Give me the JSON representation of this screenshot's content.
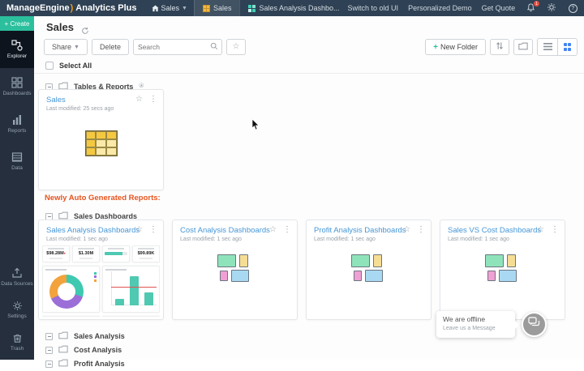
{
  "colors": {
    "accent_teal": "#2bbf9e",
    "link_blue": "#4596d6",
    "banner_orange": "#e8541e",
    "active_view_blue": "#4285f4",
    "topbar_bg": "#2f4154",
    "sidebar_bg": "#252f3d"
  },
  "topbar": {
    "brand": "ManageEngine",
    "product": "Analytics Plus",
    "workspace_selector": "Sales",
    "tabs": [
      {
        "label": "Sales"
      },
      {
        "label": "Sales Analysis Dashbo..."
      }
    ],
    "links": [
      {
        "label": "Switch to old UI"
      },
      {
        "label": "Personalized Demo"
      },
      {
        "label": "Get Quote"
      }
    ],
    "notification_count": "1"
  },
  "sidebar": {
    "create_label": "Create",
    "items": [
      {
        "label": "Explorer",
        "active": true
      },
      {
        "label": "Dashboards",
        "active": false
      },
      {
        "label": "Reports",
        "active": false
      },
      {
        "label": "Data",
        "active": false
      }
    ],
    "bottom_items": [
      {
        "label": "Data Sources"
      },
      {
        "label": "Settings"
      },
      {
        "label": "Trash"
      }
    ]
  },
  "main": {
    "title": "Sales",
    "toolbar": {
      "share_label": "Share",
      "delete_label": "Delete",
      "search_placeholder": "Search",
      "new_folder_label": "New Folder"
    },
    "select_all_label": "Select All",
    "banner": "Newly Auto Generated Reports:",
    "tables_section": {
      "name": "Tables & Reports",
      "card": {
        "title": "Sales",
        "modified": "Last modified: 25 secs ago"
      }
    },
    "dashboards_section": {
      "name": "Sales Dashboards",
      "cards": [
        {
          "title": "Sales Analysis Dashboards",
          "modified": "Last modified: 1 sec ago"
        },
        {
          "title": "Cost Analysis Dashboards",
          "modified": "Last modified: 1 sec ago"
        },
        {
          "title": "Profit Analysis Dashboards",
          "modified": "Last modified: 1 sec ago"
        },
        {
          "title": "Sales VS Cost Dashboards",
          "modified": "Last modified: 1 sec ago"
        }
      ]
    },
    "bottom_sections": [
      {
        "name": "Sales Analysis"
      },
      {
        "name": "Cost Analysis"
      },
      {
        "name": "Profit Analysis"
      }
    ]
  },
  "thumbnail": {
    "kpis": [
      {
        "value": "$98.28M",
        "trend": "down"
      },
      {
        "value": "$1.30M",
        "trend": ""
      },
      {
        "value": "",
        "trend": ""
      },
      {
        "value": "$99.89K",
        "trend": ""
      }
    ],
    "donut_segments": [
      {
        "color": "#3ec9b0",
        "pct": 30
      },
      {
        "color": "#9b6ed8",
        "pct": 38
      },
      {
        "color": "#f2a33c",
        "pct": 32
      }
    ],
    "bar_values": [
      18,
      88,
      38
    ],
    "bar_color": "#4fc9b1",
    "threshold_pct": 55
  },
  "chat": {
    "title": "We are offline",
    "subtitle": "Leave us a Message"
  }
}
